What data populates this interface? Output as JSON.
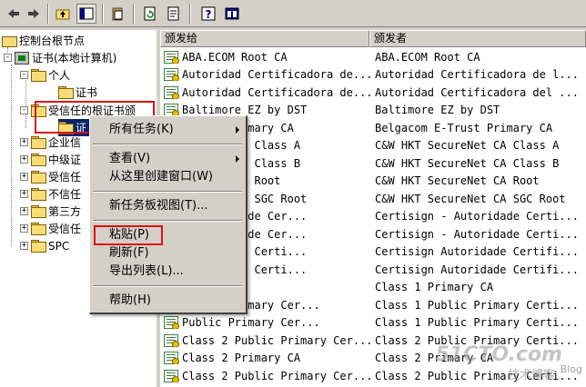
{
  "toolbar": {
    "buttons": [
      "back-icon",
      "forward-icon",
      "up-folder-icon",
      "show-tree-icon",
      "clipboard-icon",
      "refresh-icon",
      "export-icon",
      "help-icon",
      "properties-icon"
    ]
  },
  "tree": {
    "root": "控制台根节点",
    "items": [
      {
        "label": "证书(本地计算机)",
        "sign": "-"
      },
      {
        "label": "个人",
        "sign": "-"
      },
      {
        "label": "证书",
        "sign": ""
      },
      {
        "label": "受信任的根证书颁",
        "sign": "-"
      },
      {
        "label": "证",
        "sign": ""
      },
      {
        "label": "企业信",
        "sign": "+"
      },
      {
        "label": "中级证",
        "sign": "+"
      },
      {
        "label": "受信任",
        "sign": "+"
      },
      {
        "label": "不信任",
        "sign": "+"
      },
      {
        "label": "第三方",
        "sign": "+"
      },
      {
        "label": "受信任",
        "sign": "+"
      },
      {
        "label": "SPC",
        "sign": "+"
      }
    ]
  },
  "list": {
    "columns": [
      "颁发给",
      "颁发者"
    ],
    "rows": [
      {
        "issued_to": "ABA.ECOM Root CA",
        "issued_by": "ABA.ECOM Root CA"
      },
      {
        "issued_to": "Autoridad Certificadora de...",
        "issued_by": "Autoridad Certificadora de l..."
      },
      {
        "issued_to": "Autoridad Certificadora de...",
        "issued_by": "Autoridad Certificadora del ..."
      },
      {
        "issued_to": "Baltimore EZ by DST",
        "issued_by": "Baltimore EZ by DST"
      },
      {
        "issued_to": "-Trust Primary CA",
        "issued_by": "Belgacom E-Trust Primary CA"
      },
      {
        "issued_to": "cureNet CA Class A",
        "issued_by": "C&W HKT SecureNet CA Class A"
      },
      {
        "issued_to": "cureNet CA Class B",
        "issued_by": "C&W HKT SecureNet CA Class B"
      },
      {
        "issued_to": "cureNet CA Root",
        "issued_by": "C&W HKT SecureNet CA Root"
      },
      {
        "issued_to": "cureNet CA SGC Root",
        "issued_by": "C&W HKT SecureNet CA SGC Root"
      },
      {
        "issued_to": "- Autoridade Cer...",
        "issued_by": "Certisign - Autoridade Certi..."
      },
      {
        "issued_to": "- Autoridade Cer...",
        "issued_by": "Certisign - Autoridade Certi..."
      },
      {
        "issued_to": "Autoridade Certi...",
        "issued_by": "Certisign Autoridade Certifi..."
      },
      {
        "issued_to": "Autoridade Certi...",
        "issued_by": "Certisign Autoridade Certifi..."
      },
      {
        "issued_to": "rimary CA",
        "issued_by": "Class 1 Primary CA"
      },
      {
        "issued_to": "Public Primary Cer...",
        "issued_by": "Class 1 Public Primary Certi..."
      },
      {
        "issued_to": "Public Primary Cer...",
        "issued_by": "Class 1 Public Primary Certi..."
      },
      {
        "issued_to": "Class 2 Public Primary Cer...",
        "issued_by": "Class 2 Public Primary Certi..."
      },
      {
        "issued_to": "Class 2 Primary CA",
        "issued_by": "Class 2 Primary CA"
      },
      {
        "issued_to": "Class 2 Public Primary Cer...",
        "issued_by": "Class 2 Public Primary Certi..."
      },
      {
        "issued_to": "Class 2 Public Primary Cer...",
        "issued_by": "Class 2 Public Primary Certi..."
      }
    ]
  },
  "context_menu": {
    "items": [
      {
        "label": "所有任务(K)",
        "submenu": true
      },
      {
        "label": "查看(V)",
        "submenu": true
      },
      {
        "label": "从这里创建窗口(W)",
        "submenu": false
      },
      {
        "label": "新任务板视图(T)...",
        "submenu": false
      },
      {
        "label": "粘贴(P)",
        "submenu": false
      },
      {
        "label": "刷新(F)",
        "submenu": false
      },
      {
        "label": "导出列表(L)...",
        "submenu": false
      },
      {
        "label": "帮助(H)",
        "submenu": false
      }
    ]
  },
  "watermark": {
    "main": "51CTO.com",
    "sub": "技术博客",
    "blog": "Blog"
  },
  "colors": {
    "highlight_box": "#e01010",
    "window_bg": "#d4d0c8"
  }
}
